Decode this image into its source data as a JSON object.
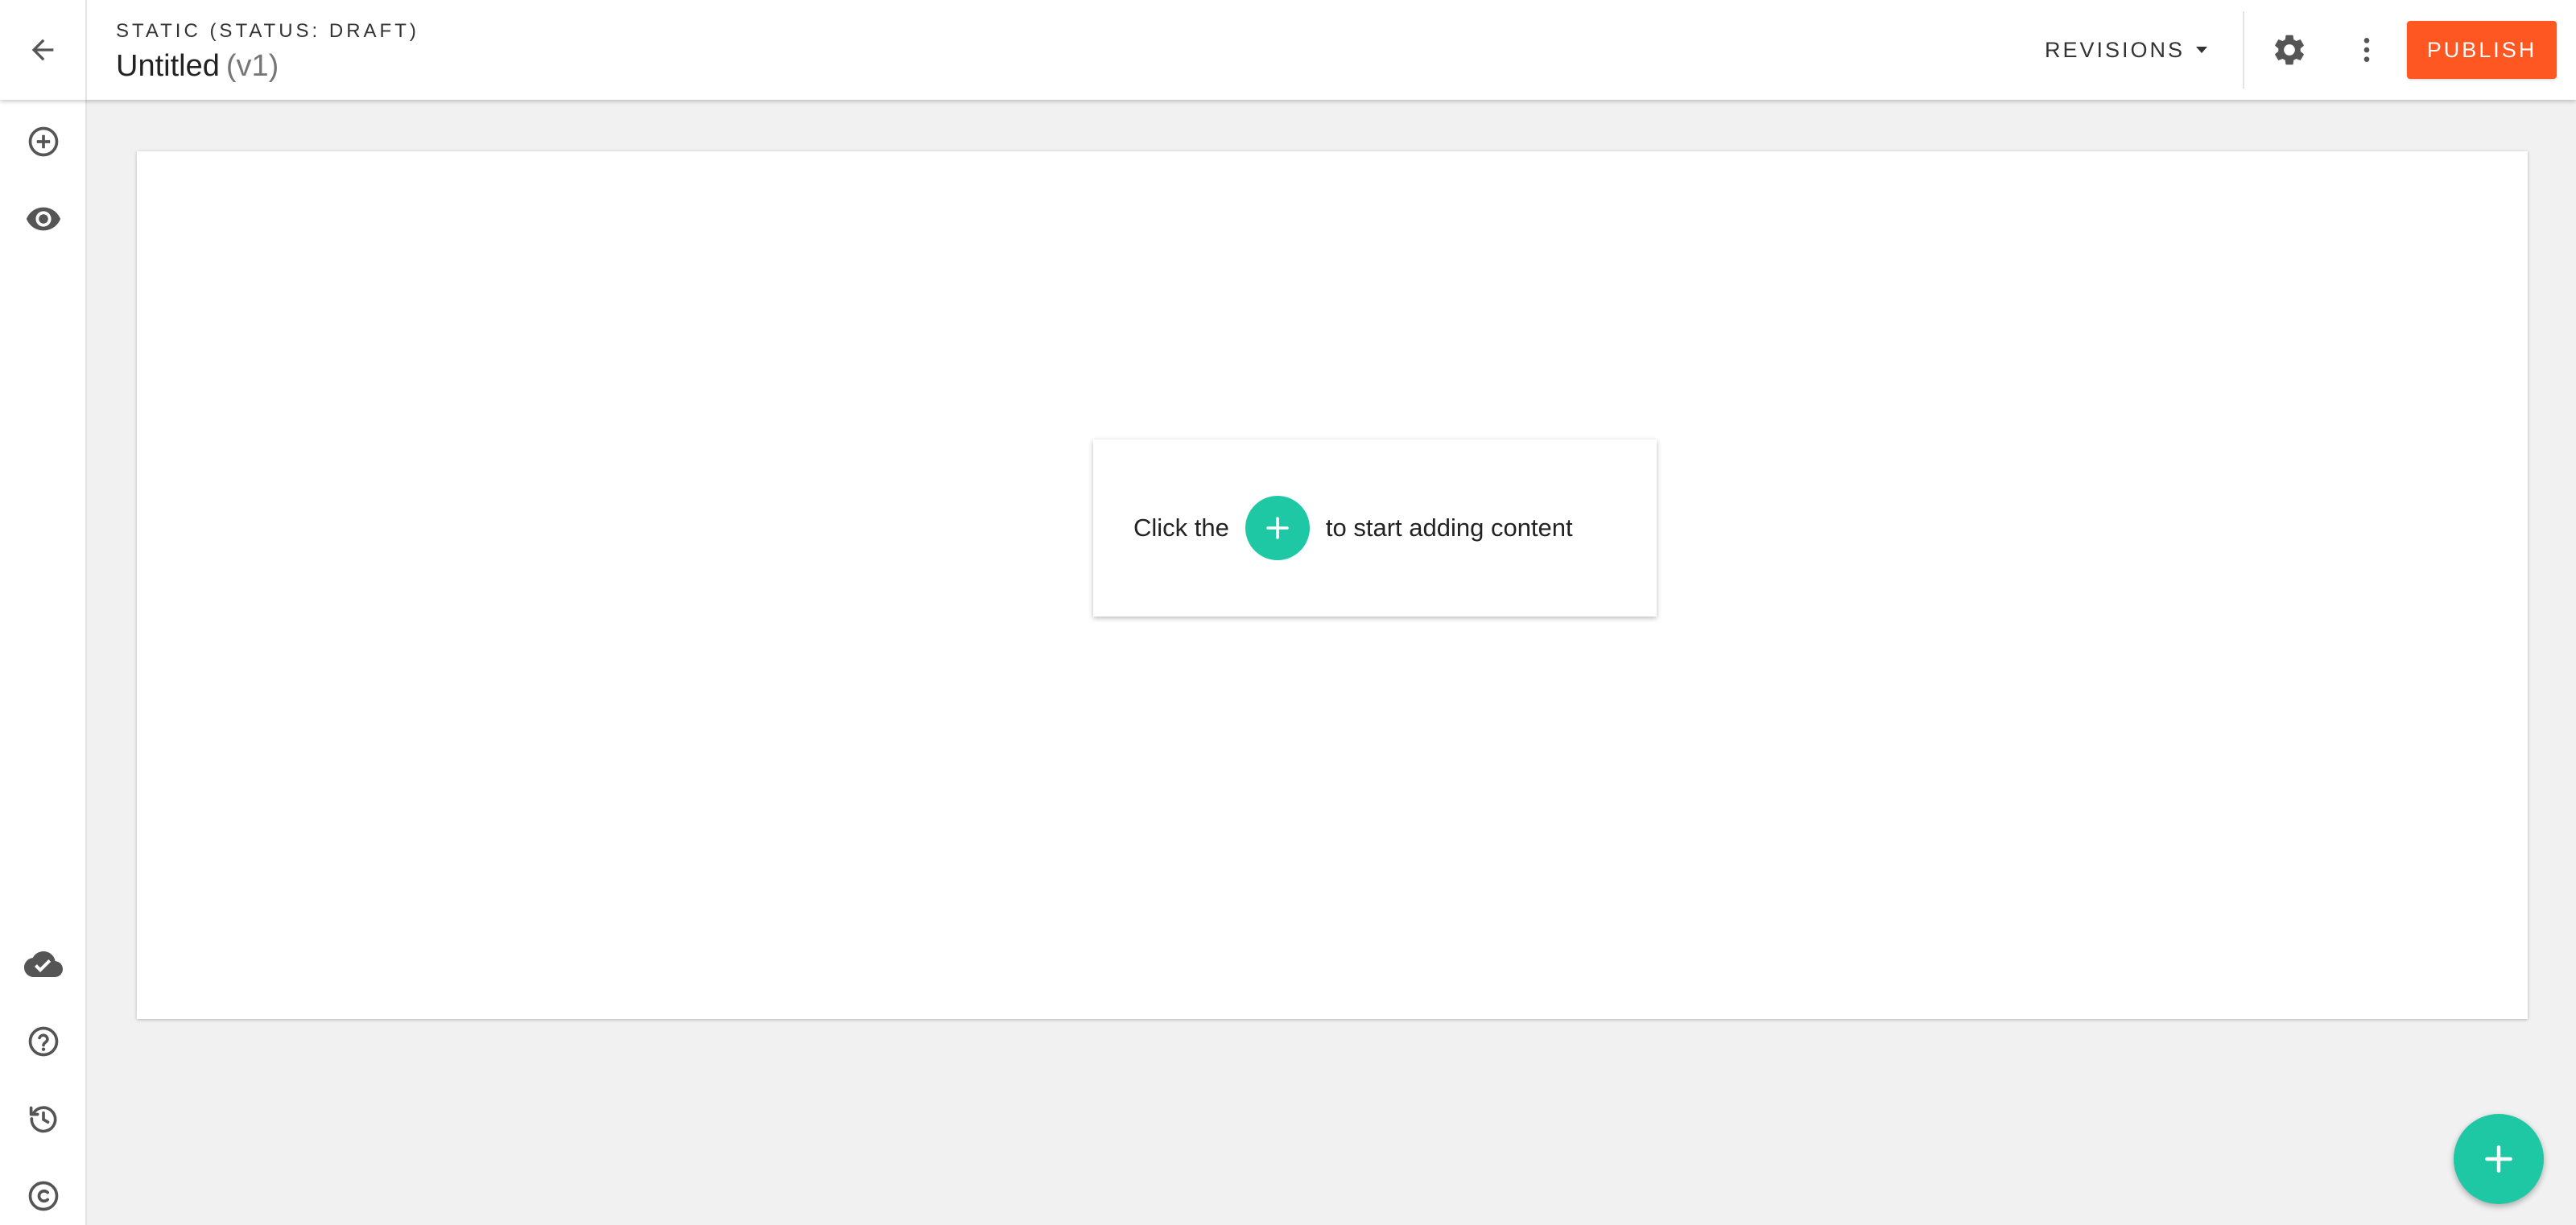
{
  "header": {
    "type_label": "STATIC (STATUS: DRAFT)",
    "title": "Untitled",
    "version": "(v1)",
    "revisions_label": "REVISIONS",
    "publish_label": "PUBLISH",
    "icons": {
      "back": "arrow-left-icon",
      "settings": "gear-icon",
      "more": "more-vertical-icon",
      "revisions_caret": "caret-down-icon"
    }
  },
  "sidebar": {
    "top_items": [
      {
        "name": "add-circle-icon"
      },
      {
        "name": "eye-icon"
      }
    ],
    "bottom_items": [
      {
        "name": "cloud-check-icon"
      },
      {
        "name": "help-icon"
      },
      {
        "name": "history-icon"
      },
      {
        "name": "copyright-icon"
      }
    ]
  },
  "canvas": {
    "hint": {
      "before": "Click the",
      "after": "to start adding content"
    }
  },
  "colors": {
    "accent": "#1ec8a5",
    "publish": "#ff5722",
    "background": "#f1f1f1",
    "icon": "#555555"
  }
}
